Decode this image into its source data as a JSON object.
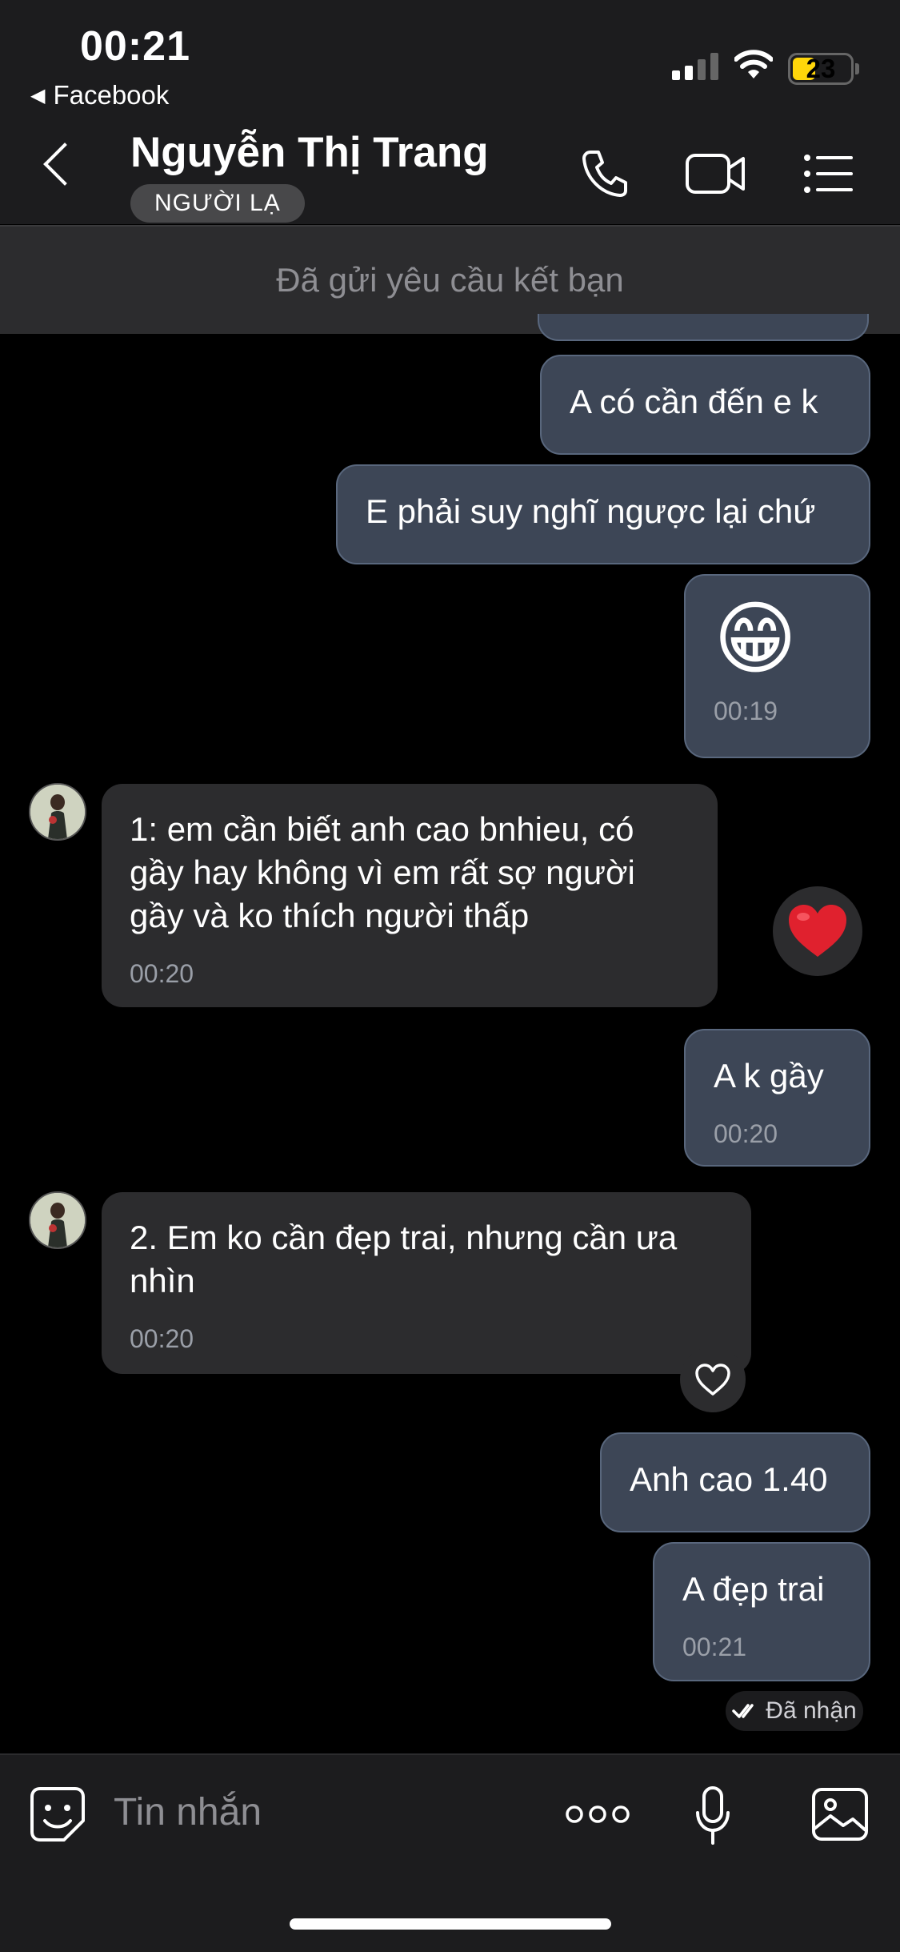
{
  "status_bar": {
    "time": "00:21",
    "back_app": "Facebook",
    "battery_level": "23"
  },
  "header": {
    "contact_name": "Nguyễn Thị Trang",
    "badge": "NGƯỜI LẠ",
    "icons": [
      "back-chevron-icon",
      "phone-icon",
      "video-call-icon",
      "menu-list-icon"
    ]
  },
  "friend_request_banner": "Đã gửi yêu cầu kết bạn",
  "messages": [
    {
      "direction": "outgoing",
      "text": "A có cần đến e k",
      "time": ""
    },
    {
      "direction": "outgoing",
      "text": "E phải suy nghĩ ngược lại chứ",
      "time": ""
    },
    {
      "direction": "outgoing",
      "text": "😁",
      "time": "00:19"
    },
    {
      "direction": "incoming",
      "text": "1: em cần biết anh cao bnhieu, có gầy hay không vì em rất sợ người gầy và ko thích người thấp",
      "time": "00:20",
      "reaction": "❤️"
    },
    {
      "direction": "outgoing",
      "text": "A k gầy",
      "time": "00:20"
    },
    {
      "direction": "incoming",
      "text": "2. Em ko cần đẹp trai, nhưng cần ưa nhìn",
      "time": "00:20"
    },
    {
      "direction": "outgoing",
      "text": "Anh cao 1.40",
      "time": ""
    },
    {
      "direction": "outgoing",
      "text": "A đẹp trai",
      "time": "00:21"
    }
  ],
  "delivery_status": "Đã nhận",
  "composer": {
    "placeholder": "Tin nhắn",
    "icons": [
      "sticker-icon",
      "more-dots-icon",
      "microphone-icon",
      "image-icon"
    ]
  },
  "colors": {
    "outgoing_bubble": "#3d4656",
    "incoming_bubble": "#2c2c2e",
    "header_bg": "#1c1c1e",
    "battery_fill": "#ffd60a"
  }
}
